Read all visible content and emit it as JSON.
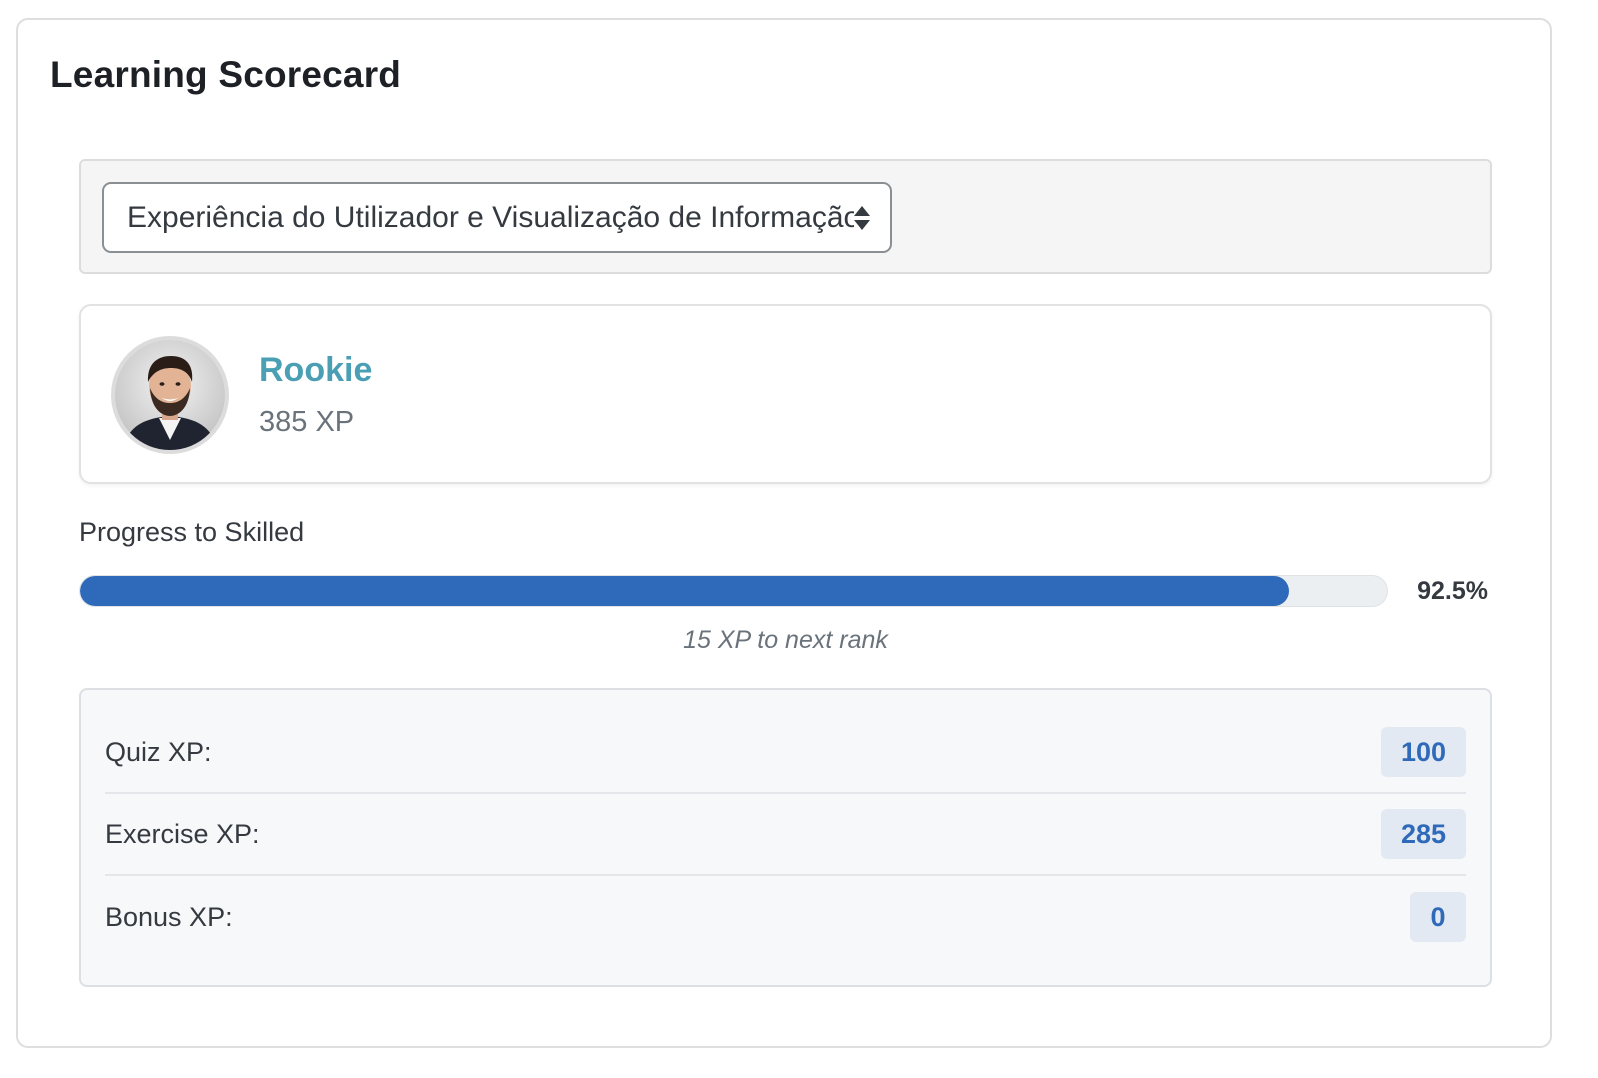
{
  "title": "Learning Scorecard",
  "course_select": {
    "selected": "Experiência do Utilizador e Visualização de Informação"
  },
  "profile": {
    "rank": "Rookie",
    "xp_total": "385 XP"
  },
  "progress": {
    "label": "Progress to Skilled",
    "percent_text": "92.5%",
    "percent_value": 92.5,
    "note": "15 XP to next rank"
  },
  "breakdown": [
    {
      "label": "Quiz XP:",
      "value": "100"
    },
    {
      "label": "Exercise XP:",
      "value": "285"
    },
    {
      "label": "Bonus XP:",
      "value": "0"
    }
  ],
  "colors": {
    "accent": "#2f6aba",
    "rank": "#4a9fb5"
  }
}
